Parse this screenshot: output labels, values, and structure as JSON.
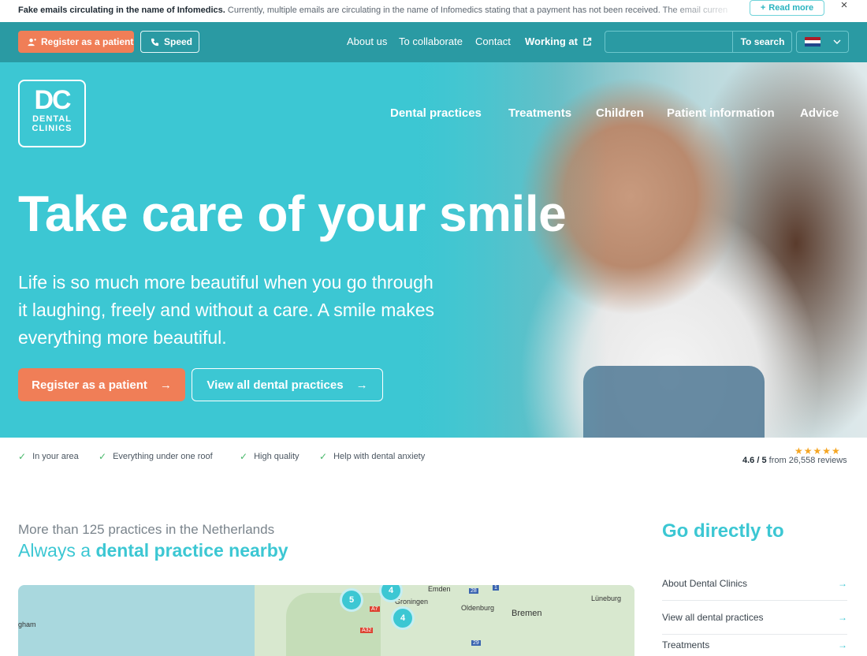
{
  "alert": {
    "title": "Fake emails circulating in the name of Infomedics.",
    "text": " Currently, multiple emails are circulating in the name of Infomedics stating that a payment has not been received. The email currently be",
    "read_more": "Read more",
    "read_more_icon": "+",
    "close_icon": "×"
  },
  "topbar": {
    "register": "Register as a patient",
    "speed": "Speed",
    "links": [
      "About us",
      "To collaborate",
      "Contact"
    ],
    "working_at": "Working at",
    "search_button": "To search",
    "search_placeholder": "",
    "language": "nl"
  },
  "logo": {
    "mark": "DC",
    "line1": "DENTAL",
    "line2": "CLINICS"
  },
  "nav": [
    "Dental practices",
    "Treatments",
    "Children",
    "Patient information",
    "Advice"
  ],
  "hero": {
    "title": "Take care of your smile",
    "subtitle": "Life is so much more beautiful when you go through it laughing, freely and without a care. A smile makes everything more beautiful.",
    "cta_primary": "Register as a patient",
    "cta_secondary": "View all dental practices",
    "arrow": "→"
  },
  "usps": [
    "In your area",
    "Everything under one roof",
    "High quality",
    "Help with dental anxiety"
  ],
  "rating": {
    "stars": "★★★★★",
    "score": "4.6 / 5",
    "reviews": "from 26,558 reviews",
    "value": 4.6
  },
  "practices": {
    "subtitle": "More than 125 practices in the Netherlands",
    "title_light": "Always a",
    "title_bold": "dental practice nearby"
  },
  "map": {
    "labels": [
      "Emden",
      "Groningen",
      "Oldenburg",
      "Bremen",
      "Lüneburg",
      "gham",
      "A7",
      "A32",
      "28",
      "29",
      "1"
    ],
    "clusters": [
      "4",
      "5",
      "4"
    ]
  },
  "go_directly": {
    "title": "Go directly to",
    "links": [
      "About Dental Clinics",
      "View all dental practices",
      "Treatments"
    ],
    "arrow": "→"
  },
  "colors": {
    "accent": "#3cc7d3",
    "topbar": "#2a9aa3",
    "cta": "#f07e57",
    "check": "#48b86a",
    "star": "#f5a623"
  }
}
